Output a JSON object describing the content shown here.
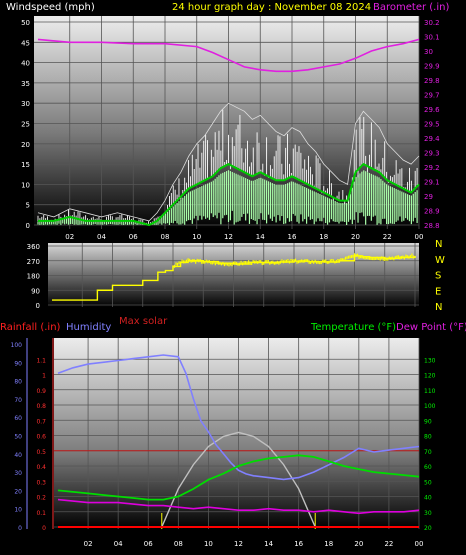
{
  "header": {
    "left_label": "Windspeed (mph)",
    "center_label": "24 hour graph day : November 08 2024",
    "right_label": "Barometer (.in)"
  },
  "direction_labels": [
    "N",
    "W",
    "S",
    "E",
    "N"
  ],
  "mid_header": {
    "rainfall": "Rainfall (.in)",
    "humidity": "Humidity",
    "max_solar": "Max solar",
    "temperature": "Temperature (°F)",
    "dew_point": "Dew Point (°F)"
  },
  "colors": {
    "windspeed": "#ffffff",
    "windavg": "#00cc00",
    "windfill": "#aaffaa",
    "barometer": "#e020e0",
    "direction": "#ffff00",
    "humidity": "#8080ff",
    "temperature": "#00dd00",
    "dewpoint": "#dd00dd",
    "solar": "#c0c0c0",
    "rain": "#ff0000",
    "rainline": "#c01818"
  },
  "chart_data": [
    {
      "type": "line",
      "name": "wind",
      "x_ticks": [
        "02",
        "04",
        "06",
        "08",
        "10",
        "12",
        "14",
        "16",
        "18",
        "20",
        "22",
        "00"
      ],
      "ylim": [
        0,
        50
      ],
      "y_ticks": [
        "0",
        "5",
        "10",
        "15",
        "20",
        "25",
        "30",
        "35",
        "40",
        "45",
        "50"
      ],
      "y2lim": [
        28.8,
        30.2
      ],
      "y2_ticks": [
        "28.8",
        "28.9",
        "29",
        "29.1",
        "29.2",
        "29.3",
        "29.4",
        "29.5",
        "29.6",
        "29.7",
        "29.8",
        "29.9",
        "30",
        "30.1",
        "30.2"
      ],
      "series": [
        {
          "key": "gust",
          "x": [
            0,
            1,
            2,
            3,
            4,
            5,
            6,
            7,
            7.5,
            8,
            8.5,
            9,
            9.5,
            10,
            10.5,
            11,
            11.5,
            12,
            12.5,
            13,
            13.5,
            14,
            14.5,
            15,
            15.5,
            16,
            16.5,
            17,
            17.5,
            18,
            18.5,
            19,
            19.5,
            20,
            20.5,
            21,
            21.5,
            22,
            22.5,
            23,
            23.5,
            24
          ],
          "values": [
            3,
            2,
            4,
            3,
            2,
            3,
            2,
            1,
            3,
            6,
            10,
            13,
            17,
            20,
            22,
            25,
            28,
            30,
            29,
            28,
            26,
            27,
            25,
            23,
            22,
            24,
            23,
            20,
            18,
            15,
            13,
            11,
            10,
            25,
            28,
            26,
            24,
            20,
            18,
            16,
            15,
            17
          ]
        },
        {
          "key": "avg",
          "x": [
            0,
            1,
            2,
            3,
            4,
            5,
            6,
            7,
            7.5,
            8,
            8.5,
            9,
            9.5,
            10,
            10.5,
            11,
            11.5,
            12,
            12.5,
            13,
            13.5,
            14,
            14.5,
            15,
            15.5,
            16,
            16.5,
            17,
            17.5,
            18,
            18.5,
            19,
            19.5,
            20,
            20.5,
            21,
            21.5,
            22,
            22.5,
            23,
            23.5,
            24
          ],
          "values": [
            1,
            1,
            2,
            1,
            1,
            1,
            1,
            0,
            1,
            3,
            5,
            7,
            9,
            10,
            11,
            12,
            14,
            15,
            14,
            13,
            12,
            13,
            12,
            11,
            11,
            12,
            11,
            10,
            9,
            8,
            7,
            6,
            6,
            13,
            15,
            14,
            13,
            11,
            10,
            9,
            8,
            10
          ]
        },
        {
          "key": "barometer",
          "x": [
            0,
            2,
            4,
            6,
            8,
            10,
            11,
            12,
            13,
            14,
            15,
            16,
            17,
            18,
            19,
            20,
            21,
            22,
            23,
            24
          ],
          "values": [
            30.08,
            30.06,
            30.06,
            30.05,
            30.05,
            30.03,
            29.99,
            29.94,
            29.89,
            29.87,
            29.86,
            29.86,
            29.87,
            29.89,
            29.91,
            29.95,
            30.0,
            30.03,
            30.05,
            30.08
          ]
        }
      ]
    },
    {
      "type": "scatter",
      "name": "wind-direction",
      "ylim": [
        0,
        360
      ],
      "y_ticks": [
        "0",
        "90",
        "180",
        "270",
        "360"
      ],
      "x": [
        0,
        1,
        2,
        2.5,
        3,
        3.5,
        4,
        4.5,
        5,
        5.5,
        6,
        6.5,
        7,
        7.5,
        8,
        8.5,
        9,
        10,
        11,
        12,
        13,
        14,
        15,
        16,
        17,
        18,
        19,
        20,
        20.5,
        21,
        22,
        23,
        24
      ],
      "values": [
        30,
        30,
        30,
        30,
        90,
        90,
        120,
        120,
        120,
        120,
        150,
        150,
        200,
        210,
        235,
        260,
        270,
        265,
        255,
        250,
        260,
        258,
        262,
        268,
        265,
        262,
        270,
        300,
        295,
        290,
        285,
        290,
        300
      ]
    },
    {
      "type": "line",
      "name": "temperature-humidity",
      "x_ticks": [
        "02",
        "04",
        "06",
        "08",
        "10",
        "12",
        "14",
        "16",
        "18",
        "20",
        "22",
        "00"
      ],
      "humidity_ylim": [
        0,
        100
      ],
      "humidity_ticks": [
        "0",
        "10",
        "20",
        "30",
        "40",
        "50",
        "60",
        "70",
        "80",
        "90",
        "100"
      ],
      "rain_ylim": [
        0,
        1.2
      ],
      "rain_ticks": [
        "0",
        "0.1",
        "0.2",
        "0.3",
        "0.4",
        "0.5",
        "0.6",
        "0.7",
        "0.8",
        "0.9",
        "1",
        "1.1"
      ],
      "temp_ylim": [
        20,
        140
      ],
      "temp_ticks": [
        "20",
        "30",
        "40",
        "50",
        "60",
        "70",
        "80",
        "90",
        "100",
        "110",
        "120",
        "130"
      ],
      "rain_reference_line": 0.5,
      "solar_marks": [
        6.9,
        17.1
      ],
      "series": [
        {
          "key": "humidity",
          "x": [
            0,
            1,
            2,
            3,
            4,
            5,
            6,
            7,
            8,
            8.5,
            9,
            9.5,
            10,
            10.5,
            11,
            11.5,
            12,
            12.5,
            13,
            14,
            15,
            16,
            17,
            18,
            19,
            20,
            21,
            22,
            23,
            24
          ],
          "values": [
            84,
            87,
            89,
            90,
            91,
            92,
            93,
            94,
            93,
            84,
            70,
            58,
            52,
            45,
            40,
            35,
            31,
            29,
            28,
            27,
            26,
            27,
            30,
            34,
            38,
            43,
            41,
            42,
            43,
            44
          ]
        },
        {
          "key": "temperature",
          "x": [
            0,
            1,
            2,
            3,
            4,
            5,
            6,
            7,
            8,
            9,
            10,
            11,
            12,
            13,
            14,
            15,
            16,
            17,
            18,
            19,
            20,
            21,
            22,
            23,
            24
          ],
          "values": [
            44,
            43,
            42,
            41,
            40,
            39,
            38,
            38,
            40,
            45,
            51,
            55,
            60,
            63,
            65,
            66,
            67,
            66,
            63,
            60,
            58,
            56,
            55,
            54,
            53
          ]
        },
        {
          "key": "dewpoint",
          "x": [
            0,
            1,
            2,
            3,
            4,
            5,
            6,
            7,
            8,
            9,
            10,
            11,
            12,
            13,
            14,
            15,
            16,
            17,
            18,
            19,
            20,
            21,
            22,
            23,
            24
          ],
          "values": [
            38,
            37,
            36,
            36,
            36,
            35,
            34,
            34,
            33,
            32,
            33,
            32,
            31,
            31,
            32,
            31,
            31,
            30,
            31,
            30,
            29,
            30,
            30,
            30,
            31
          ]
        },
        {
          "key": "solar",
          "x": [
            6.9,
            8,
            9,
            10,
            11,
            12,
            13,
            14,
            15,
            16,
            17.1
          ],
          "values": [
            0,
            38,
            62,
            80,
            90,
            94,
            90,
            80,
            62,
            38,
            0
          ]
        },
        {
          "key": "rain",
          "x": [
            0,
            24
          ],
          "values": [
            0,
            0
          ]
        }
      ]
    }
  ]
}
